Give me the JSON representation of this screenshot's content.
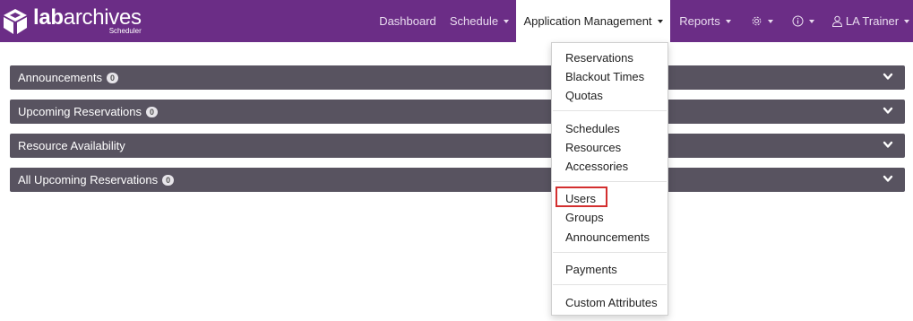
{
  "brand": {
    "name_bold": "lab",
    "name_rest": "archives",
    "subtitle": "Scheduler"
  },
  "nav": {
    "dashboard": "Dashboard",
    "schedule": "Schedule",
    "application_management": "Application Management",
    "reports": "Reports",
    "user": "LA Trainer"
  },
  "panels": [
    {
      "title": "Announcements",
      "badge": "0"
    },
    {
      "title": "Upcoming Reservations",
      "badge": "0"
    },
    {
      "title": "Resource Availability",
      "badge": ""
    },
    {
      "title": "All Upcoming Reservations",
      "badge": "0"
    }
  ],
  "dropdown": {
    "items": [
      "Reservations",
      "Blackout Times",
      "Quotas",
      "Schedules",
      "Resources",
      "Accessories",
      "Users",
      "Groups",
      "Announcements",
      "Payments",
      "Custom Attributes"
    ],
    "highlighted": "Users"
  },
  "colors": {
    "navbar": "#6b2d86",
    "panel": "#585360",
    "highlight_border": "#d32f2f"
  },
  "icons": {
    "logo": "labarchives-cube-logo",
    "settings": "gear-icon",
    "help": "info-icon",
    "user": "user-icon",
    "panel_toggle": "chevron-down-icon"
  }
}
